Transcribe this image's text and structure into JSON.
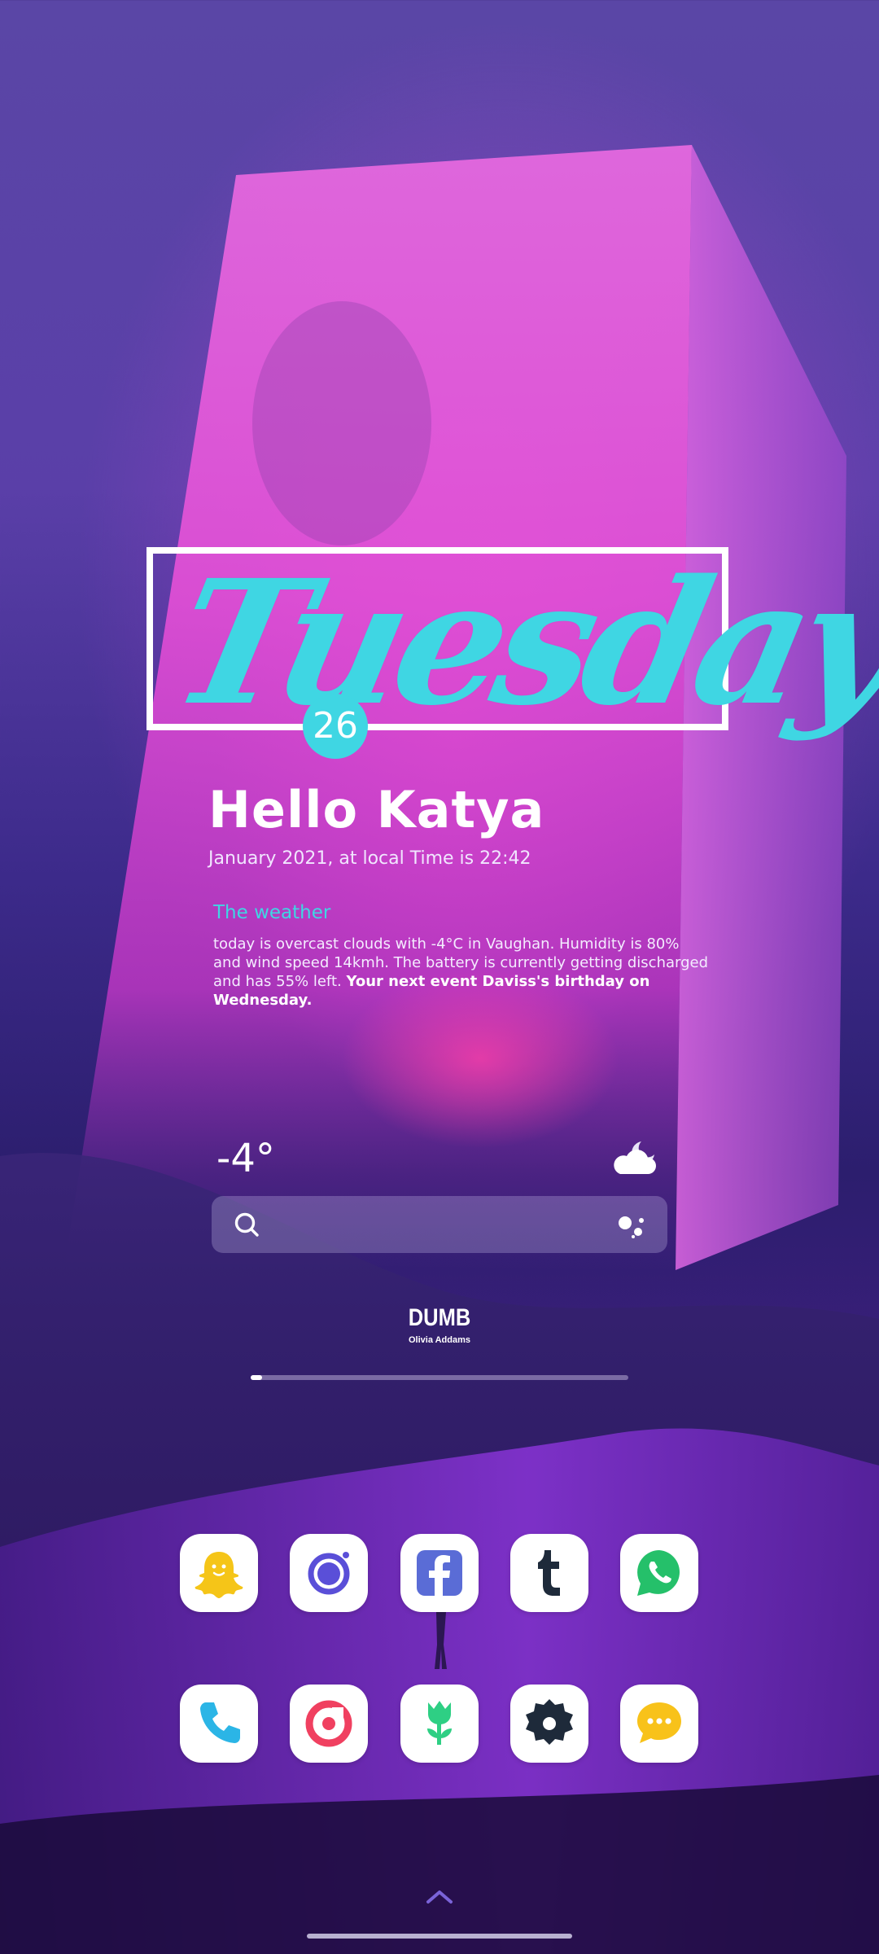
{
  "clock_widget": {
    "day_name": "Tuesday",
    "day_number": "26",
    "greeting": "Hello Katya",
    "datetime_line": "January 2021, at local Time is 22:42"
  },
  "weather_widget": {
    "title": "The weather",
    "description": "today is overcast clouds with -4°C in Vaughan. Humidity is 80% and wind speed 14kmh. The battery is currently getting discharged and has 55% left. ",
    "event_text": "Your next event Daviss's birthday on Wednesday.",
    "temperature": "-4°",
    "condition_icon": "cloudy-night-icon"
  },
  "search": {
    "icon": "search-icon",
    "assistant_icon": "google-assistant-icon"
  },
  "music_widget": {
    "song": "DUMB",
    "artist": "Olivia Addams",
    "progress_fraction": 0.03
  },
  "dock_row_1": [
    {
      "app": "snapchat",
      "icon": "ghost-icon",
      "accent": "#f5c518"
    },
    {
      "app": "camera",
      "icon": "lens-icon",
      "accent": "#5a4fd8"
    },
    {
      "app": "facebook",
      "icon": "facebook-icon",
      "accent": "#5a6cd6"
    },
    {
      "app": "tumblr",
      "icon": "tumblr-icon",
      "accent": "#1e2a3a"
    },
    {
      "app": "whatsapp",
      "icon": "whatsapp-icon",
      "accent": "#25c06a"
    }
  ],
  "dock_row_2": [
    {
      "app": "phone",
      "icon": "phone-icon",
      "accent": "#2bb5e6"
    },
    {
      "app": "music",
      "icon": "music-icon",
      "accent": "#f04060"
    },
    {
      "app": "gallery",
      "icon": "tulip-icon",
      "accent": "#2ecf84"
    },
    {
      "app": "settings",
      "icon": "gear-icon",
      "accent": "#1e2a3a"
    },
    {
      "app": "messages",
      "icon": "chat-icon",
      "accent": "#f8c21a"
    }
  ],
  "colors": {
    "accent_cyan": "#3fd6e3",
    "text": "#ffffff"
  }
}
